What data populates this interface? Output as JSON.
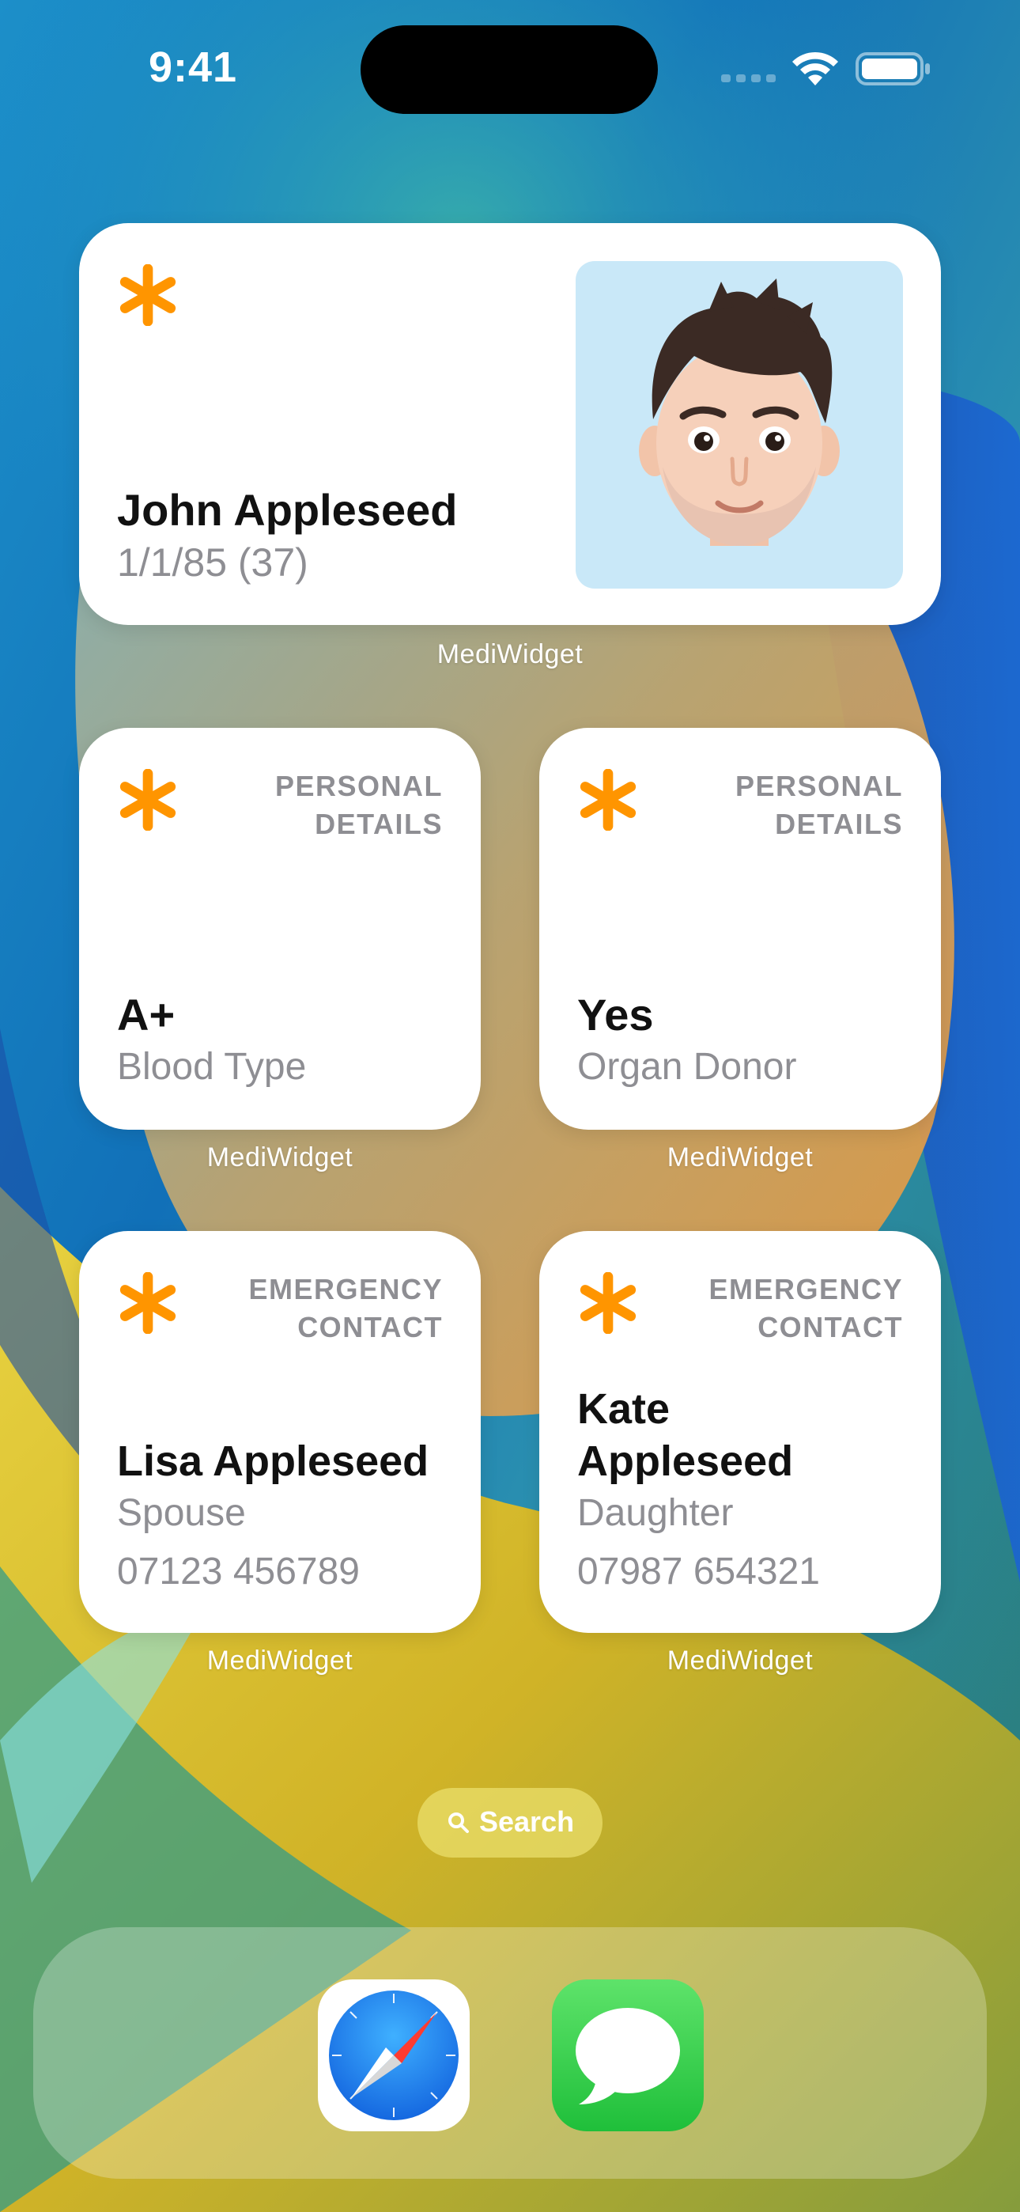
{
  "status_bar": {
    "time": "9:41"
  },
  "widgets": {
    "profile": {
      "name": "John Appleseed",
      "dob": "1/1/85 (37)",
      "label": "MediWidget",
      "icon": "asterisk-icon"
    },
    "blood_type": {
      "header_line1": "PERSONAL",
      "header_line2": "DETAILS",
      "value": "A+",
      "sub": "Blood Type",
      "label": "MediWidget"
    },
    "organ_donor": {
      "header_line1": "PERSONAL",
      "header_line2": "DETAILS",
      "value": "Yes",
      "sub": "Organ Donor",
      "label": "MediWidget"
    },
    "contact1": {
      "header_line1": "EMERGENCY",
      "header_line2": "CONTACT",
      "name": "Lisa Appleseed",
      "relation": "Spouse",
      "phone": "07123 456789",
      "label": "MediWidget"
    },
    "contact2": {
      "header_line1": "EMERGENCY",
      "header_line2": "CONTACT",
      "name_line1": "Kate",
      "name_line2": "Appleseed",
      "relation": "Daughter",
      "phone": "07987 654321",
      "label": "MediWidget"
    }
  },
  "search": {
    "label": "Search",
    "icon": "search-icon"
  },
  "dock": {
    "apps": [
      {
        "name": "Safari",
        "icon": "safari-icon"
      },
      {
        "name": "Messages",
        "icon": "messages-icon"
      }
    ]
  },
  "colors": {
    "accent_orange": "#ff9500",
    "secondary_text": "#8e8e93",
    "primary_text": "#111111",
    "avatar_background": "#c9e8f8",
    "messages_green": "#34c759",
    "safari_blue": "#1f8ef1"
  }
}
